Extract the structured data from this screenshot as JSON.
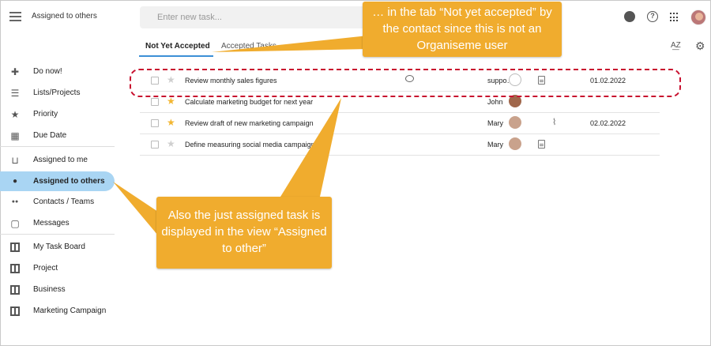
{
  "header": {
    "menu_icon": "hamburger-menu-icon",
    "title": "Assigned to others",
    "new_task_placeholder": "Enter new task...",
    "icons": [
      "notification-icon",
      "help-icon",
      "apps-grid-icon",
      "user-avatar"
    ]
  },
  "tabs": [
    {
      "label": "Not Yet Accepted",
      "active": true
    },
    {
      "label": "Accepted Tasks",
      "active": false
    }
  ],
  "toolbar": {
    "sort_label": "A͟Z",
    "settings_icon": "gear-icon"
  },
  "sidebar": {
    "items": [
      {
        "label": "Do now!",
        "icon": "gamepad-icon",
        "icon_glyph": "✚"
      },
      {
        "label": "Lists/Projects",
        "icon": "list-icon",
        "icon_glyph": "☰"
      },
      {
        "label": "Priority",
        "icon": "star-icon",
        "icon_glyph": "★"
      },
      {
        "label": "Due Date",
        "icon": "calendar-icon",
        "icon_glyph": "▦"
      },
      {
        "label": "Assigned to me",
        "icon": "inbox-icon",
        "icon_glyph": "⊔"
      },
      {
        "label": "Assigned to others",
        "icon": "person-icon",
        "icon_glyph": "●",
        "active": true
      },
      {
        "label": "Contacts / Teams",
        "icon": "people-icon",
        "icon_glyph": "●●"
      },
      {
        "label": "Messages",
        "icon": "chat-icon",
        "icon_glyph": "▢"
      },
      {
        "label": "My Task Board",
        "icon": "board-icon"
      },
      {
        "label": "Project",
        "icon": "board-icon"
      },
      {
        "label": "Business",
        "icon": "board-icon"
      },
      {
        "label": "Marketing Campaign",
        "icon": "board-icon"
      }
    ]
  },
  "tasks": [
    {
      "title": "Review monthly sales figures",
      "starred": false,
      "assignee": "suppo…",
      "has_comment": true,
      "has_note": true,
      "has_attachment": false,
      "due": "01.02.2022"
    },
    {
      "title": "Calculate marketing budget for next year",
      "starred": true,
      "assignee": "John",
      "has_comment": false,
      "has_note": false,
      "has_attachment": false,
      "due": ""
    },
    {
      "title": "Review draft of new marketing campaign",
      "starred": true,
      "assignee": "Mary",
      "has_comment": false,
      "has_note": false,
      "has_attachment": true,
      "due": "02.02.2022"
    },
    {
      "title": "Define measuring social media campaign",
      "starred": false,
      "assignee": "Mary",
      "has_comment": false,
      "has_note": true,
      "has_attachment": false,
      "due": ""
    }
  ],
  "callouts": {
    "top": "… in the tab “Not yet accepted” by the contact since this is not an Organiseme user",
    "bottom": "Also the just assigned task is displayed in the view “Assigned to other”"
  },
  "colors": {
    "accent": "#3c8fd6",
    "active_bg": "#a9d5f3",
    "callout": "#f0ac2e",
    "star": "#f2b632",
    "dashed": "#c8102e"
  }
}
